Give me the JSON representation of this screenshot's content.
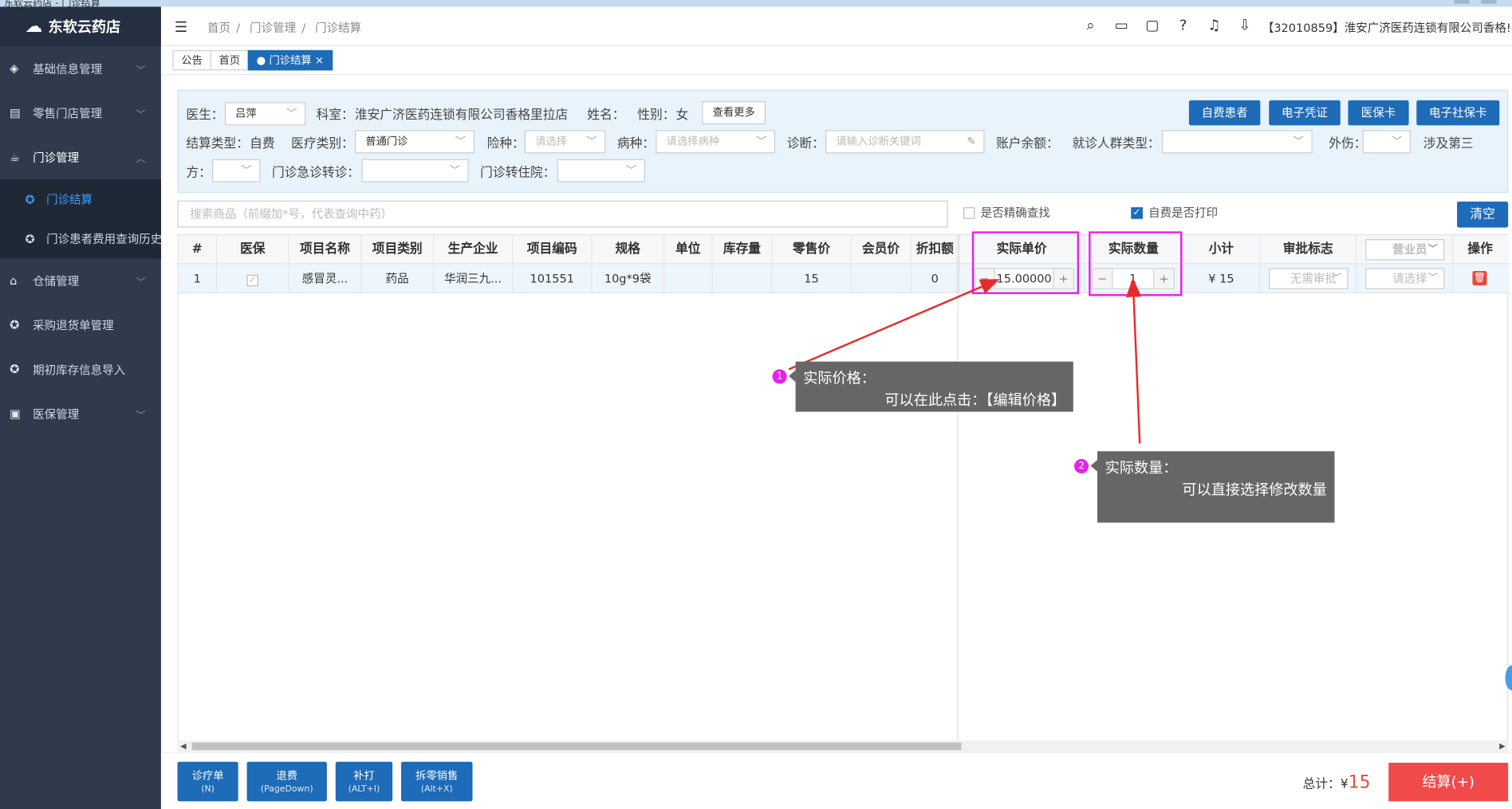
{
  "app": {
    "name": "东软云药店",
    "title_strip": "东软云药店 - 门诊结算"
  },
  "sidebar": {
    "items": [
      {
        "label": "基础信息管理",
        "icon": "layers-icon"
      },
      {
        "label": "零售门店管理",
        "icon": "store-icon"
      },
      {
        "label": "门诊管理",
        "icon": "clinic-icon",
        "open": true
      },
      {
        "label": "仓储管理",
        "icon": "warehouse-icon"
      },
      {
        "label": "采购退货单管理",
        "icon": "gear-icon"
      },
      {
        "label": "期初库存信息导入",
        "icon": "gear-icon"
      },
      {
        "label": "医保管理",
        "icon": "card-icon"
      }
    ],
    "subitems": [
      {
        "label": "门诊结算",
        "active": true
      },
      {
        "label": "门诊患者费用查询历史"
      }
    ]
  },
  "header": {
    "breadcrumb": [
      "首页",
      "门诊管理",
      "门诊结算"
    ],
    "company": "【32010859】淮安广济医药连锁有限公司香格!"
  },
  "tabs": [
    {
      "label": "公告"
    },
    {
      "label": "首页"
    },
    {
      "label": "● 门诊结算 ×",
      "active": true
    }
  ],
  "form": {
    "doctor_label": "医生：",
    "doctor_value": "吕萍",
    "dept_label": "科室：",
    "dept_value": "淮安广济医药连锁有限公司香格里拉店",
    "name_label": "姓名：",
    "gender_label": "性别：",
    "gender_value": "女",
    "more_btn": "查看更多",
    "settle_type_label": "结算类型：",
    "settle_type_value": "自费",
    "med_type_label": "医疗类别：",
    "med_type_value": "普通门诊",
    "insurance_label": "险种：",
    "insurance_placeholder": "请选择",
    "disease_label": "病种：",
    "disease_placeholder": "请选择病种",
    "diagnosis_label": "诊断：",
    "diagnosis_placeholder": "请输入诊断关键词",
    "balance_label": "账户余额：",
    "crowd_label": "就诊人群类型：",
    "injury_label": "外伤：",
    "third_label_a": "涉及第三",
    "third_label_b": "方：",
    "emergency_label": "门诊急诊转诊：",
    "hospital_label": "门诊转住院：",
    "btn_selfpay": "自费患者",
    "btn_evoucher": "电子凭证",
    "btn_insurance_card": "医保卡",
    "btn_social_card": "电子社保卡"
  },
  "search": {
    "placeholder": "搜索商品（前缀加*号，代表查询中药）",
    "exact_label": "是否精确查找",
    "print_label": "自费是否打印",
    "clear_btn": "清空"
  },
  "table": {
    "headers": [
      "#",
      "医保",
      "项目名称",
      "项目类别",
      "生产企业",
      "项目编码",
      "规格",
      "单位",
      "库存量",
      "零售价",
      "会员价",
      "折扣额",
      "实际单价",
      "实际数量",
      "小计",
      "审批标志",
      "营业员",
      "操作"
    ],
    "rows": [
      {
        "idx": "1",
        "name": "感冒灵...",
        "category": "药品",
        "maker": "华润三九...",
        "code": "101551",
        "spec": "10g*9袋",
        "unit": "",
        "stock": "",
        "retail": "15",
        "member": "",
        "discount": "0",
        "actual_price": "15.00000",
        "actual_qty": "1",
        "subtotal": "¥ 15",
        "approval": "无需审批",
        "clerk": "请选择"
      }
    ]
  },
  "annotations": {
    "a1_num": "1",
    "a1_title": "实际价格：",
    "a1_desc": "可以在此点击：【编辑价格】",
    "a2_num": "2",
    "a2_title": "实际数量：",
    "a2_desc": "可以直接选择修改数量"
  },
  "footer": {
    "buttons": [
      {
        "label": "诊疗单",
        "key": "(N)"
      },
      {
        "label": "退费",
        "key": "(PageDown)"
      },
      {
        "label": "补打",
        "key": "(ALT+I)"
      },
      {
        "label": "拆零销售",
        "key": "(Alt+X)"
      }
    ],
    "total_label": "总计：¥",
    "total_value": "15",
    "settle_btn": "结算(+)"
  },
  "colors": {
    "accent": "#1e6bb8",
    "sidebar": "#2f3b4c",
    "highlight": "#e820e8",
    "danger": "#f04a4a"
  }
}
